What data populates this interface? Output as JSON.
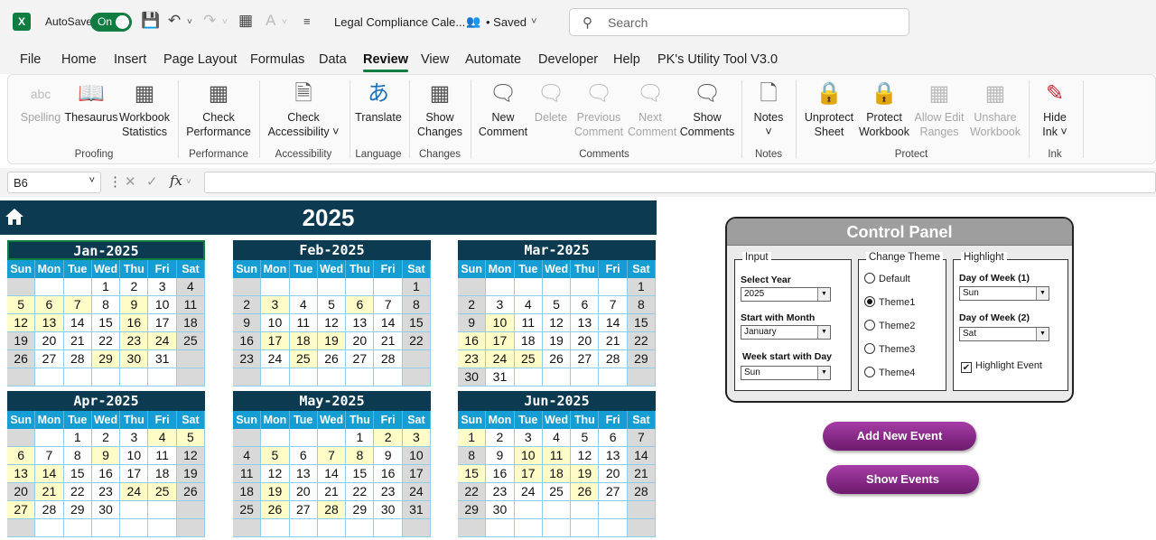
{
  "titlebar": {
    "autosave_label": "AutoSave",
    "autosave_state": "On",
    "doc_title": "Legal Compliance Cale...",
    "saved_status": "• Saved",
    "search_placeholder": "Search"
  },
  "menu": [
    "File",
    "Home",
    "Insert",
    "Page Layout",
    "Formulas",
    "Data",
    "Review",
    "View",
    "Automate",
    "Developer",
    "Help",
    "PK's Utility Tool V3.0"
  ],
  "menu_active": "Review",
  "ribbon": {
    "spelling": "Spelling",
    "thesaurus": "Thesaurus",
    "workbook_statistics_1": "Workbook",
    "workbook_statistics_2": "Statistics",
    "check_performance_1": "Check",
    "check_performance_2": "Performance",
    "check_accessibility_1": "Check",
    "check_accessibility_2": "Accessibility ˅",
    "translate": "Translate",
    "show_changes_1": "Show",
    "show_changes_2": "Changes",
    "new_comment_1": "New",
    "new_comment_2": "Comment",
    "delete": "Delete",
    "previous_comment_1": "Previous",
    "previous_comment_2": "Comment",
    "next_comment_1": "Next",
    "next_comment_2": "Comment",
    "show_comments_1": "Show",
    "show_comments_2": "Comments",
    "notes": "Notes",
    "notes_chevron": "˅",
    "unprotect_sheet_1": "Unprotect",
    "unprotect_sheet_2": "Sheet",
    "protect_workbook_1": "Protect",
    "protect_workbook_2": "Workbook",
    "allow_edit_ranges_1": "Allow Edit",
    "allow_edit_ranges_2": "Ranges",
    "unshare_workbook_1": "Unshare",
    "unshare_workbook_2": "Workbook",
    "hide_ink_1": "Hide",
    "hide_ink_2": "Ink ˅",
    "groups": {
      "proofing": "Proofing",
      "performance": "Performance",
      "accessibility": "Accessibility",
      "language": "Language",
      "changes": "Changes",
      "comments": "Comments",
      "notes": "Notes",
      "protect": "Protect",
      "ink": "Ink"
    }
  },
  "formula_bar": {
    "name_box": "B6",
    "fx": "fx",
    "value": ""
  },
  "sheet": {
    "year": "2025",
    "weekdays": [
      "Sun",
      "Mon",
      "Tue",
      "Wed",
      "Thu",
      "Fri",
      "Sat"
    ],
    "months": [
      {
        "title": "Jan-2025",
        "first_dow": 3,
        "days": 31,
        "highlight": [
          5,
          6,
          7,
          9,
          12,
          13,
          16,
          23,
          24,
          29,
          30
        ]
      },
      {
        "title": "Feb-2025",
        "first_dow": 6,
        "days": 28,
        "highlight": [
          3,
          6,
          17,
          18,
          19,
          25
        ]
      },
      {
        "title": "Mar-2025",
        "first_dow": 6,
        "days": 31,
        "highlight": [
          10,
          16,
          17,
          23,
          24,
          25
        ]
      },
      {
        "title": "Apr-2025",
        "first_dow": 2,
        "days": 30,
        "highlight": [
          4,
          5,
          6,
          9,
          13,
          14,
          21,
          24,
          25,
          27
        ]
      },
      {
        "title": "May-2025",
        "first_dow": 4,
        "days": 31,
        "highlight": [
          2,
          3,
          5,
          7,
          8,
          19,
          26,
          28
        ]
      },
      {
        "title": "Jun-2025",
        "first_dow": 0,
        "days": 30,
        "highlight": [
          1,
          10,
          11,
          15,
          17,
          18,
          19,
          26
        ]
      }
    ]
  },
  "control_panel": {
    "title": "Control Panel",
    "input_legend": "Input",
    "select_year_label": "Select Year",
    "select_year_value": "2025",
    "start_month_label": "Start with Month",
    "start_month_value": "January",
    "week_start_label": "Week start with Day",
    "week_start_value": "Sun",
    "theme_legend": "Change Theme",
    "themes": [
      "Default",
      "Theme1",
      "Theme2",
      "Theme3",
      "Theme4"
    ],
    "theme_selected": "Theme1",
    "highlight_legend": "Highlight",
    "dow1_label": "Day of Week (1)",
    "dow1_value": "Sun",
    "dow2_label": "Day of Week (2)",
    "dow2_value": "Sat",
    "highlight_event_label": "Highlight Event",
    "highlight_event_checked": true
  },
  "buttons": {
    "add_new_event": "Add New Event",
    "show_events": "Show Events"
  },
  "colors": {
    "header_dark": "#0c3a50",
    "weekday_blue": "#169ed4",
    "weekend_gray": "#d9d9d9",
    "event_yellow": "#fffcc7",
    "button_purple": "#8a2a8a",
    "excel_green": "#107c41"
  }
}
